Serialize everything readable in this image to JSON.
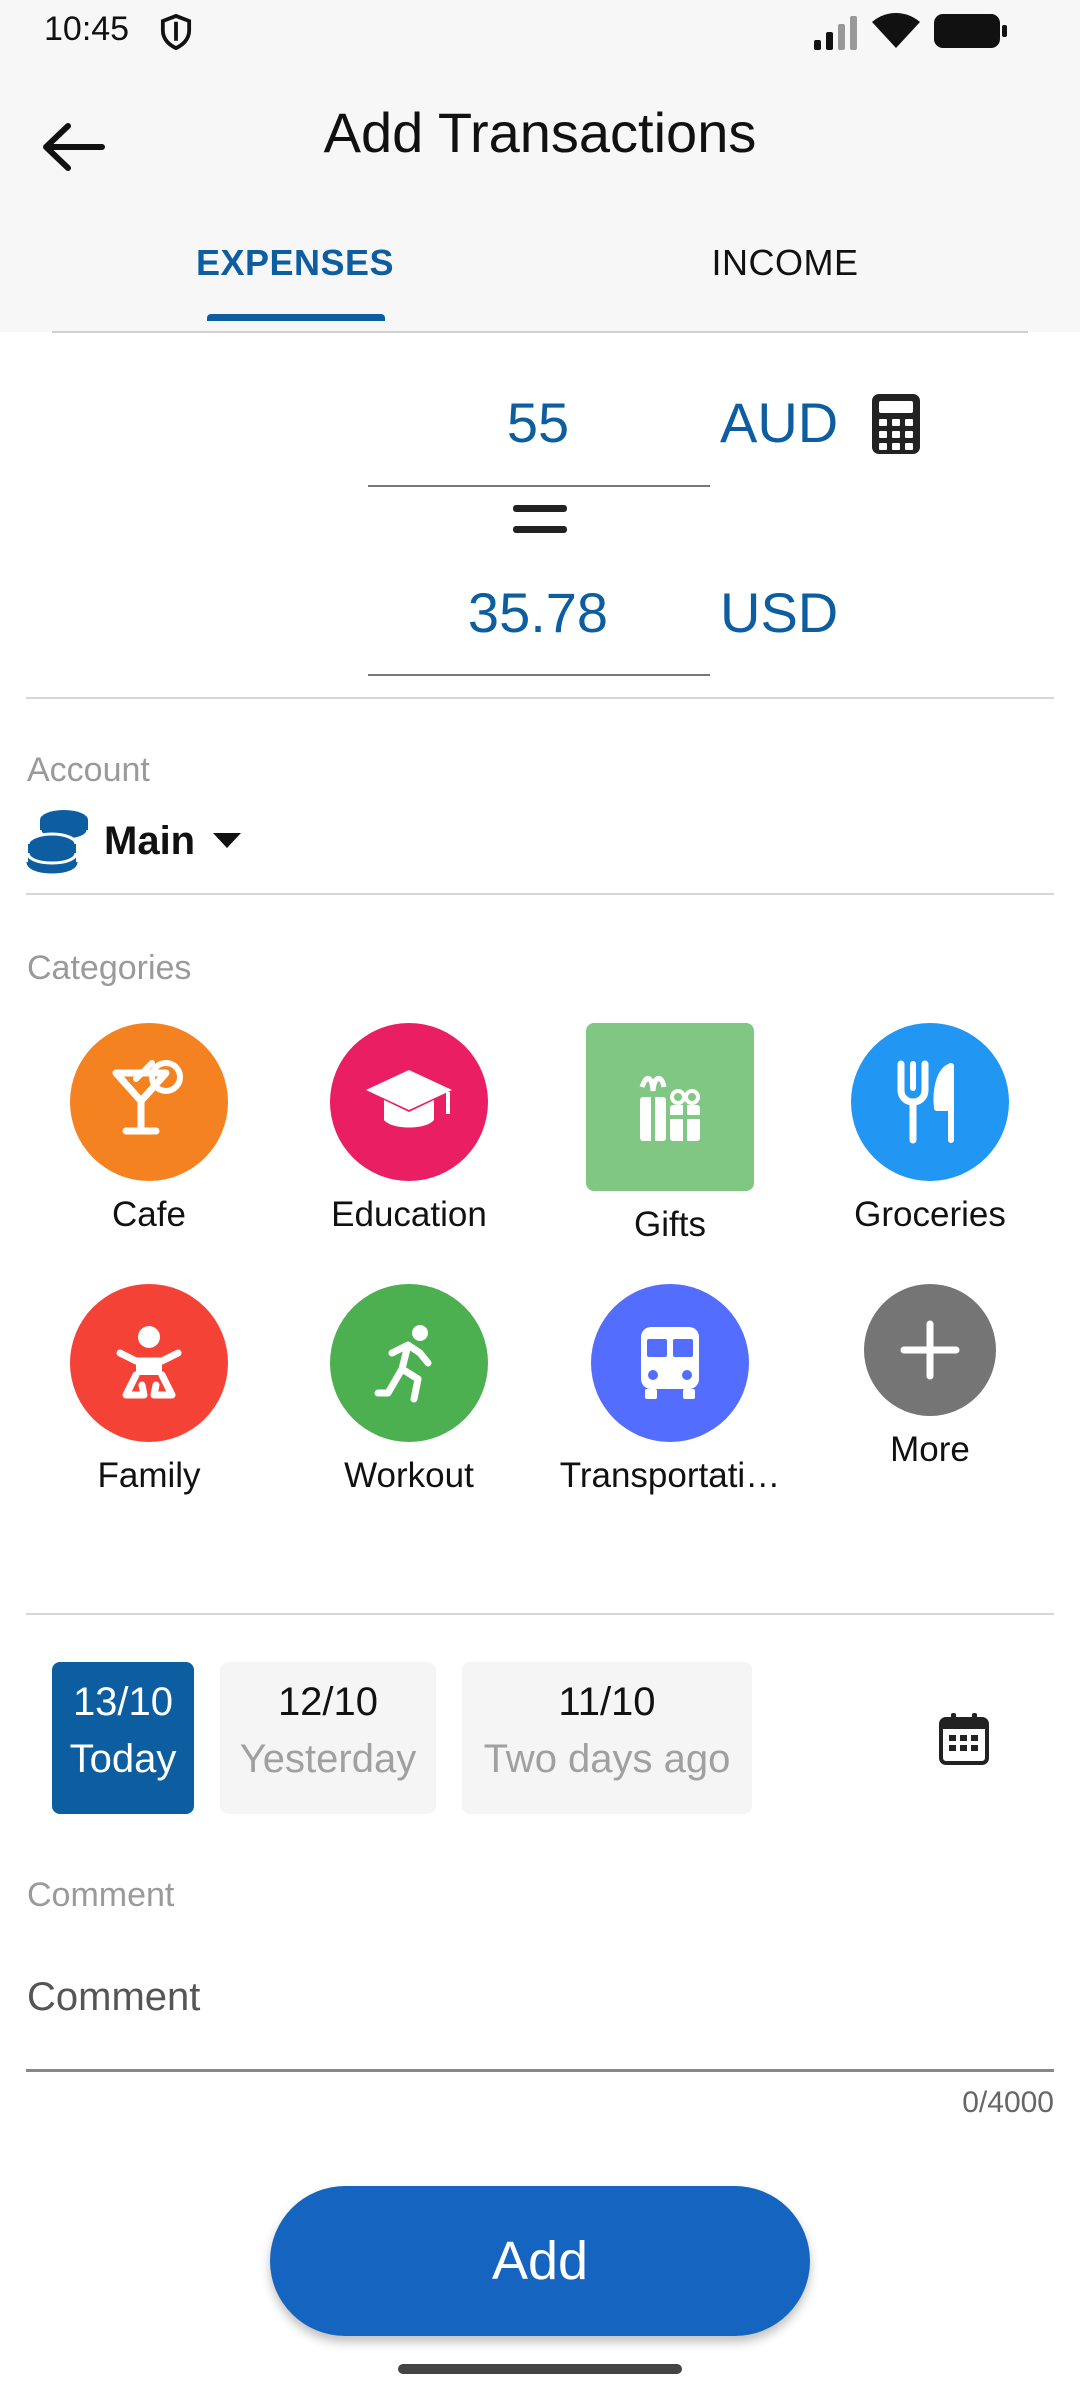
{
  "status_bar": {
    "time": "10:45"
  },
  "header": {
    "title": "Add Transactions",
    "tabs": [
      {
        "label": "EXPENSES",
        "selected": true
      },
      {
        "label": "INCOME",
        "selected": false
      }
    ]
  },
  "amounts": {
    "source_value": "55",
    "source_currency": "AUD",
    "converted_value": "35.78",
    "converted_currency": "USD"
  },
  "account": {
    "label": "Account",
    "name": "Main"
  },
  "categories": {
    "label": "Categories",
    "items": [
      {
        "label": "Cafe",
        "color": "#f58220",
        "icon": "cocktail-icon"
      },
      {
        "label": "Education",
        "color": "#e91e63",
        "icon": "graduation-cap-icon"
      },
      {
        "label": "Gifts",
        "color": "#81c784",
        "icon": "gift-icon",
        "selected": true
      },
      {
        "label": "Groceries",
        "color": "#2196f3",
        "icon": "fork-knife-icon"
      },
      {
        "label": "Family",
        "color": "#f44336",
        "icon": "baby-icon"
      },
      {
        "label": "Workout",
        "color": "#4caf50",
        "icon": "running-icon"
      },
      {
        "label": "Transportati…",
        "color": "#536dfe",
        "icon": "bus-icon"
      },
      {
        "label": "More",
        "color": "#757575",
        "icon": "plus-icon"
      }
    ]
  },
  "dates": [
    {
      "date": "13/10",
      "label": "Today",
      "selected": true
    },
    {
      "date": "12/10",
      "label": "Yesterday",
      "selected": false
    },
    {
      "date": "11/10",
      "label": "Two days ago",
      "selected": false
    }
  ],
  "comment": {
    "label": "Comment",
    "placeholder": "Comment",
    "counter": "0/4000"
  },
  "add_button": {
    "label": "Add"
  },
  "colors": {
    "accent": "#0d5ea0",
    "button": "#1565c0"
  }
}
